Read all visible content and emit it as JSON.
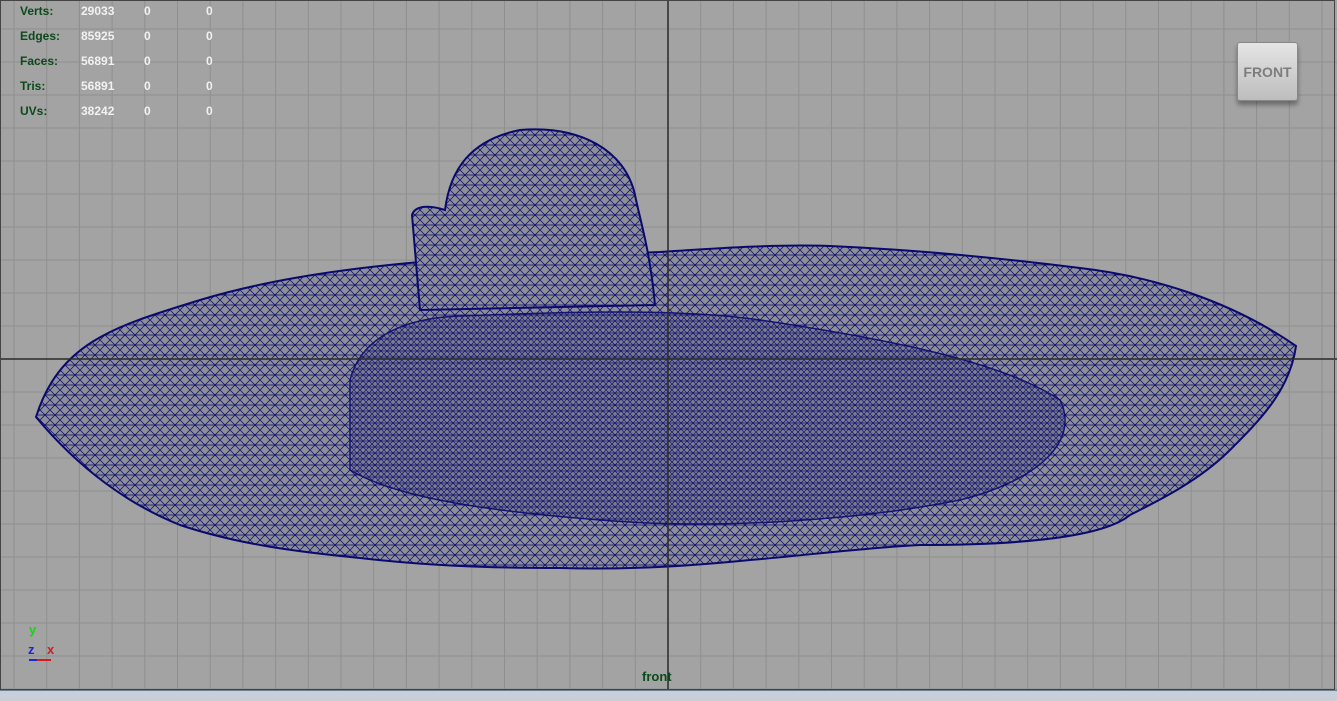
{
  "hud": {
    "rows": [
      {
        "label": "Verts:",
        "values": [
          "29033",
          "0",
          "0"
        ]
      },
      {
        "label": "Edges:",
        "values": [
          "85925",
          "0",
          "0"
        ]
      },
      {
        "label": "Faces:",
        "values": [
          "56891",
          "0",
          "0"
        ]
      },
      {
        "label": "Tris:",
        "values": [
          "56891",
          "0",
          "0"
        ]
      },
      {
        "label": "UVs:",
        "values": [
          "38242",
          "0",
          "0"
        ]
      }
    ]
  },
  "viewcube": {
    "label": "FRONT"
  },
  "camera": {
    "name": "front"
  },
  "axis": {
    "y": "y",
    "z": "z",
    "x": "x"
  },
  "colors": {
    "background": "#a3a3a3",
    "grid": "#8f8f8f",
    "axis_line": "#2a2a2a",
    "wireframe": "#0a0a6e",
    "hud_label": "#0b4a1c",
    "hud_value": "#f2f2f2"
  }
}
